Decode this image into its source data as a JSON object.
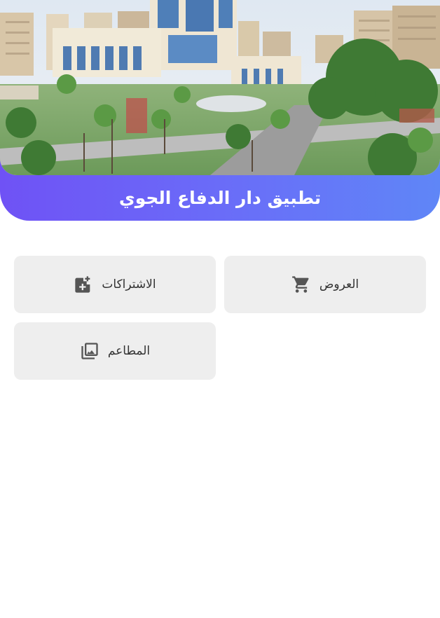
{
  "header": {
    "title": "تطبيق دار الدفاع الجوي",
    "photo_icon": "building-campus-photo"
  },
  "menu": [
    {
      "label": "العروض",
      "icon": "cart-icon"
    },
    {
      "label": "الاشتراكات",
      "icon": "add-ticket-icon"
    },
    {
      "label": "المطاعم",
      "icon": "photo-library-icon"
    }
  ],
  "colors": {
    "gradient_start": "#6f52f5",
    "gradient_end": "#5f86f7",
    "card_bg": "#eeeeee",
    "icon": "#555555"
  }
}
